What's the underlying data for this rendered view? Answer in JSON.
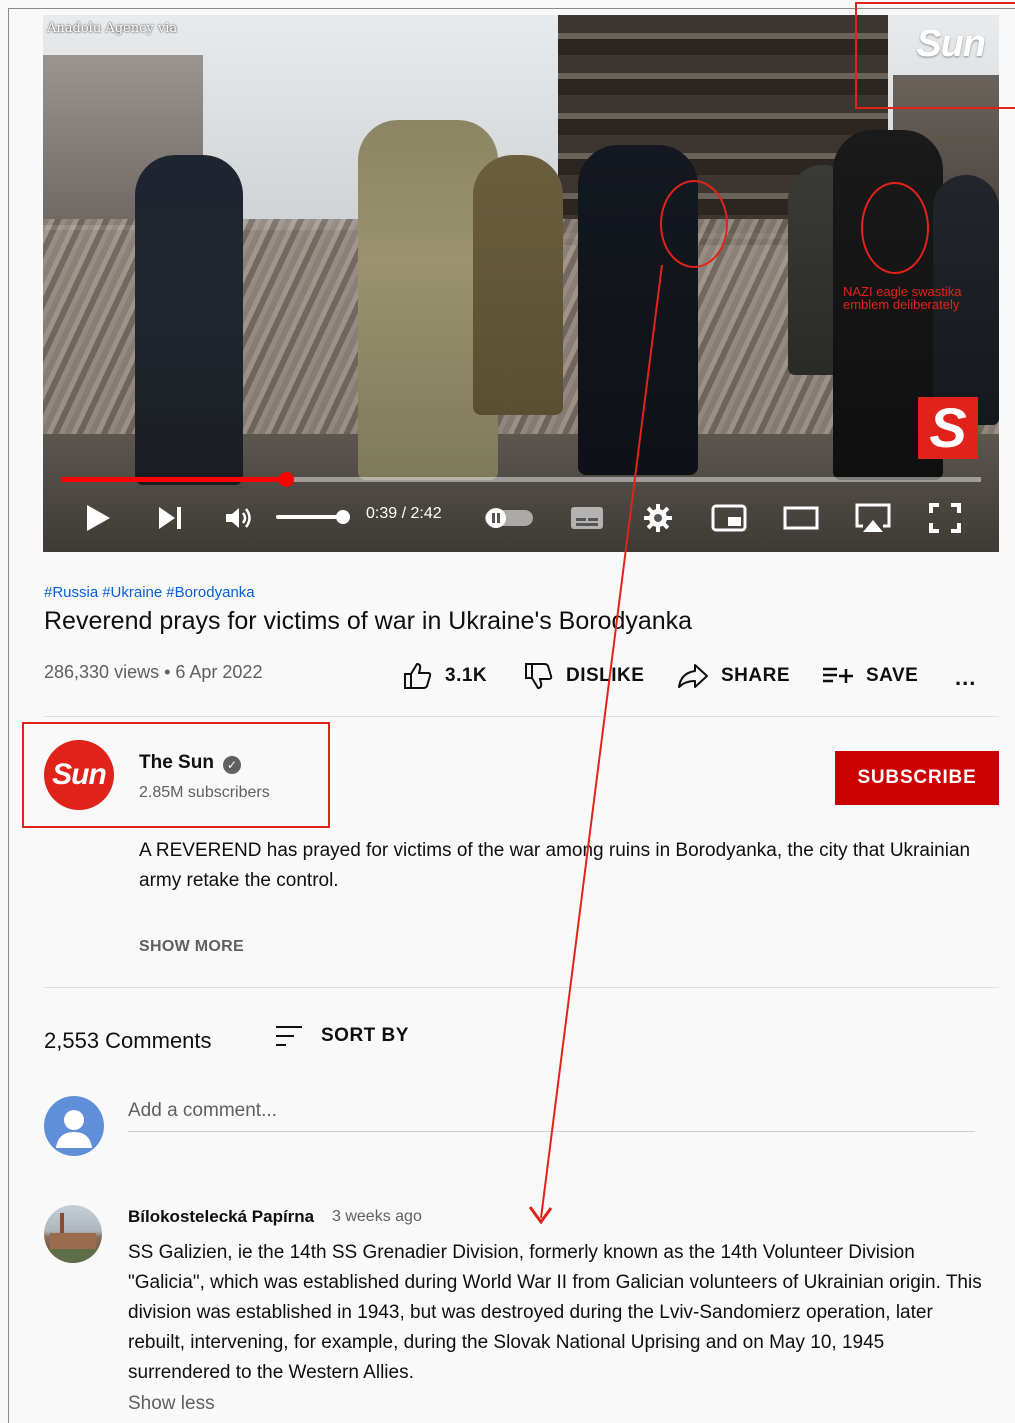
{
  "video": {
    "source_credit": "Anadolu Agency via",
    "brand_logo": "Sun",
    "badge": "S",
    "annotation": "NAZI eagle swastika emblem deliberately",
    "player": {
      "progress_fraction": 0.245,
      "volume_fraction": 0.95,
      "time": "0:39 / 2:42"
    }
  },
  "hashtags": [
    "#Russia",
    "#Ukraine",
    "#Borodyanka"
  ],
  "title": "Reverend prays for victims of war in Ukraine's Borodyanka",
  "stats": {
    "views_date": "286,330 views • 6 Apr 2022",
    "like_count": "3.1K",
    "dislike_label": "DISLIKE",
    "share_label": "SHARE",
    "save_label": "SAVE",
    "more_label": "..."
  },
  "channel": {
    "avatar_text": "Sun",
    "name": "The Sun",
    "subscribers": "2.85M subscribers",
    "subscribe_label": "SUBSCRIBE"
  },
  "description": {
    "text": "A REVEREND has prayed for victims of the war among ruins in Borodyanka, the city that Ukrainian army retake the control.",
    "show_more_label": "SHOW MORE"
  },
  "comments": {
    "count": "2,553 Comments",
    "sort_label": "SORT BY",
    "add_placeholder": "Add a comment...",
    "items": [
      {
        "author": "Bílokostelecká Papírna",
        "time": "3 weeks ago",
        "text": "SS Galizien, ie the 14th SS Grenadier Division, formerly known as the 14th Volunteer Division \"Galicia\", which was established during World War II from Galician volunteers of Ukrainian origin. This division was established in 1943, but was destroyed during the Lviv-Sandomierz operation, later rebuilt, intervening, for example, during the Slovak National Uprising and on May 10, 1945 surrendered to the Western Allies.",
        "show_less_label": "Show less"
      }
    ]
  },
  "colors": {
    "accent_red": "#cc0000",
    "annotation_red": "#e2231a",
    "link_blue": "#065fd4"
  }
}
